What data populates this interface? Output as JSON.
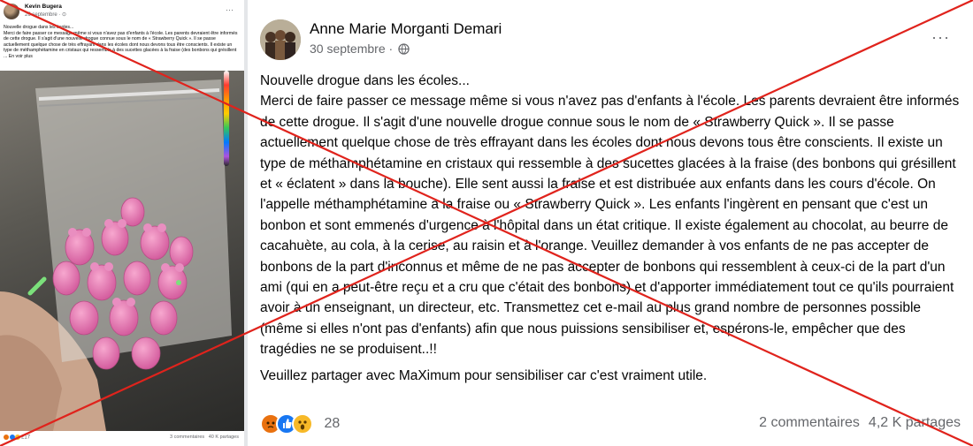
{
  "thumbnail": {
    "author": "Kevin Bugera",
    "date": "26 septembre · ⊙",
    "more": "···",
    "text_lines": [
      "Nouvelle drogue dans les écoles...",
      "Merci de faire passer ce message même si vous n'avez pas d'enfants à l'école. Les parents devraient être informés de cette drogue. Il s'agit d'une nouvelle drogue connue sous le nom de « Strawberry Quick ». Il se passe actuellement quelque chose de très effrayant dans les écoles dont nous devons tous être conscients. Il existe un type de méthamphétamine en cristaux qui ressemble à des sucettes glacées à la fraise (des bonbons qui grésillent ... En voir plus"
    ],
    "reaction_count": "217",
    "comments": "3 commentaires",
    "shares": "40 K partages"
  },
  "post": {
    "author": "Anne Marie Morganti Demari",
    "date": "30 septembre · ",
    "more": "···",
    "paragraphs": [
      "Nouvelle drogue dans les écoles...",
      "Merci de faire passer ce message même si vous n'avez pas d'enfants à l'école. Les parents devraient être informés de cette drogue. Il s'agit d'une nouvelle drogue connue sous le nom de « Strawberry Quick ». Il se passe actuellement quelque chose de très effrayant dans les écoles dont nous devons tous être conscients. Il existe un type de méthamphétamine en cristaux qui ressemble à des sucettes glacées à la fraise (des bonbons qui grésillent et « éclatent » dans la bouche). Elle sent aussi la fraise et est distribuée aux enfants dans les cours d'école. On l'appelle méthamphétamine à la fraise ou « Strawberry Quick ». Les enfants l'ingèrent en pensant que c'est un bonbon et sont emmenés d'urgence à l'hôpital dans un état critique.  Il existe également au chocolat, au beurre de cacahuète, au cola, à la cerise, au raisin et à l'orange. Veuillez demander à vos enfants de ne pas accepter de bonbons de la part d'inconnus et même de ne pas accepter de bonbons qui ressemblent à ceux-ci de la part d'un ami (qui en a peut-être reçu et a cru que c'était des bonbons) et d'apporter immédiatement tout ce qu'ils pourraient avoir à un enseignant, un directeur, etc. Transmettez cet e-mail au plus grand nombre de personnes possible (même si elles n'ont pas d'enfants) afin que nous puissions sensibiliser et, espérons-le, empêcher que des tragédies ne se produisent..!!"
    ],
    "share_line": "Veuillez partager avec MaXimum pour sensibiliser car c'est vraiment utile.",
    "reaction_count": "28",
    "reactions": [
      "angry-icon",
      "like-icon",
      "wow-icon"
    ],
    "comments": "2 commentaires",
    "shares": "4,2 K partages"
  },
  "colors": {
    "cross": "#e0231c",
    "like": "#1877f2",
    "angry": "#e9710f",
    "wow": "#f7b928",
    "candy": "#e77fb3"
  }
}
